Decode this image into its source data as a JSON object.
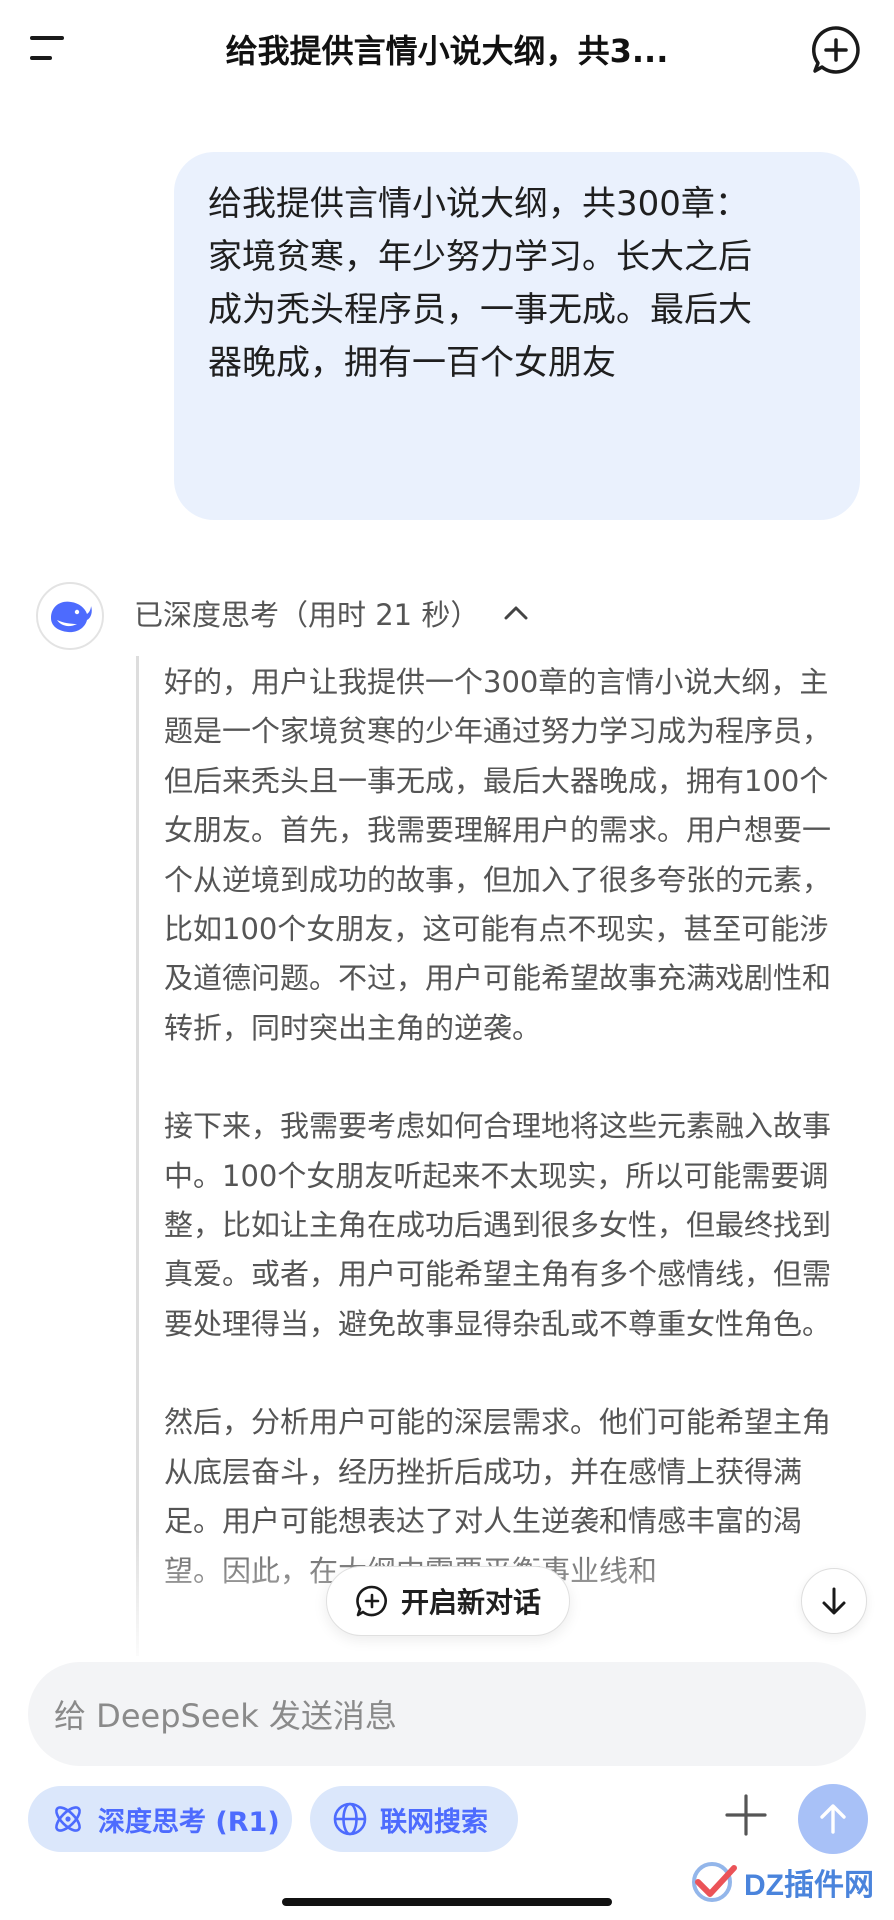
{
  "header": {
    "title": "给我提供言情小说大纲，共3..."
  },
  "user_message": {
    "lines": [
      "给我提供言情小说大纲，共300章：",
      "家境贫寒，年少努力学习。长大之后",
      "成为秃头程序员，一事无成。最后大",
      "器晚成，拥有一百个女朋友"
    ]
  },
  "thinking": {
    "label": "已深度思考（用时 21 秒）",
    "paragraphs": [
      "好的，用户让我提供一个300章的言情小说大纲，主题是一个家境贫寒的少年通过努力学习成为程序员，但后来秃头且一事无成，最后大器晚成，拥有100个女朋友。首先，我需要理解用户的需求。用户想要一个从逆境到成功的故事，但加入了很多夸张的元素，比如100个女朋友，这可能有点不现实，甚至可能涉及道德问题。不过，用户可能希望故事充满戏剧性和转折，同时突出主角的逆袭。",
      "接下来，我需要考虑如何合理地将这些元素融入故事中。100个女朋友听起来不太现实，所以可能需要调整，比如让主角在成功后遇到很多女性，但最终找到真爱。或者，用户可能希望主角有多个感情线，但需要处理得当，避免故事显得杂乱或不尊重女性角色。",
      "然后，分析用户可能的深层需求。他们可能希望主角从底层奋斗，经历挫折后成功，并在感情上获得满足。用户可能想表达了对人生逆袭和情感丰富的渴望。因此，在大纲中需要平衡事业线和"
    ]
  },
  "floating": {
    "new_chat_label": "开启新对话"
  },
  "composer": {
    "placeholder": "给 DeepSeek 发送消息",
    "deep_think_label": "深度思考 (R1)",
    "web_search_label": "联网搜索"
  },
  "watermark": {
    "text": "DZ插件网"
  },
  "colors": {
    "accent": "#4d6bfe",
    "bubble": "#eaf1fd",
    "chip": "#dbe7fb",
    "send_disabled": "#a8c1f7"
  }
}
